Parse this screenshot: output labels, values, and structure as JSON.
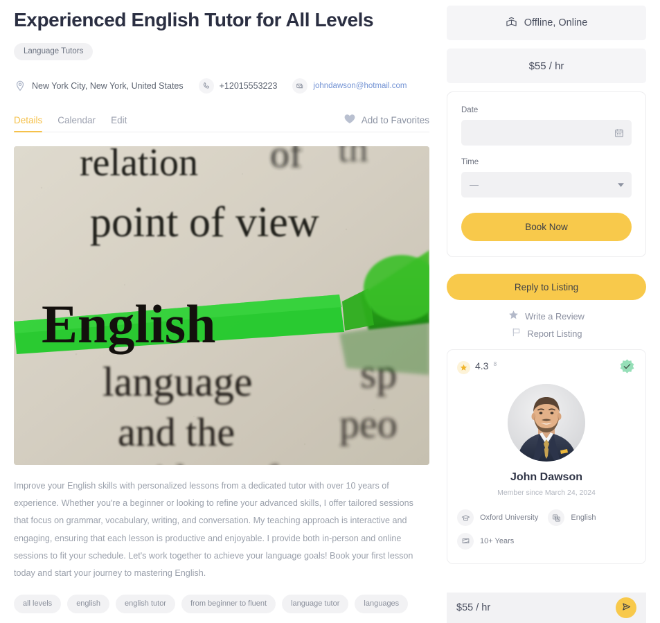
{
  "listing": {
    "title": "Experienced English Tutor for All Levels",
    "category_badge": "Language Tutors",
    "location": "New York City, New York, United States",
    "phone": "+12015553223",
    "email": "johndawson@hotmail.com",
    "description": "Improve your English skills with personalized lessons from a dedicated tutor with over 10 years of experience. Whether you're a beginner or looking to refine your advanced skills, I offer tailored sessions that focus on grammar, vocabulary, writing, and conversation. My teaching approach is interactive and engaging, ensuring that each lesson is productive and enjoyable. I provide both in-person and online sessions to fit your schedule. Let's work together to achieve your language goals! Book your first lesson today and start your journey to mastering English.",
    "hero_image_alt": "Dictionary page with the word English highlighted in green"
  },
  "tabs": {
    "items": [
      {
        "label": "Details",
        "active": true
      },
      {
        "label": "Calendar",
        "active": false
      },
      {
        "label": "Edit",
        "active": false
      }
    ],
    "favorites_label": "Add to Favorites"
  },
  "tags": [
    "all levels",
    "english",
    "english tutor",
    "from beginner to fluent",
    "language tutor",
    "languages"
  ],
  "sidebar": {
    "service_mode": "Offline, Online",
    "price": "$55 / hr",
    "booking": {
      "date_label": "Date",
      "date_value": "",
      "date_placeholder": "",
      "time_label": "Time",
      "time_value": "—",
      "book_button": "Book Now"
    },
    "reply_button": "Reply to Listing",
    "actions": [
      {
        "label": "Write a Review",
        "icon": "star-icon"
      },
      {
        "label": "Report Listing",
        "icon": "flag-icon"
      }
    ],
    "profile": {
      "rating": "4.3",
      "rating_count": "8",
      "verified": true,
      "name": "John Dawson",
      "member_since": "Member since March 24, 2024",
      "info": [
        {
          "label": "Oxford University",
          "icon": "graduation-cap-icon"
        },
        {
          "label": "English",
          "icon": "translate-icon"
        },
        {
          "label": "10+ Years",
          "icon": "experience-icon"
        }
      ]
    },
    "bottom_bar": {
      "price": "$55 / hr",
      "send_icon": "send-icon"
    }
  },
  "colors": {
    "accent": "#f8c94b",
    "tab_active": "#f5c14b",
    "link": "#7393d4",
    "verified": "#8fdcb4",
    "muted_bg": "#f2f2f4",
    "title": "#2b2f42"
  }
}
